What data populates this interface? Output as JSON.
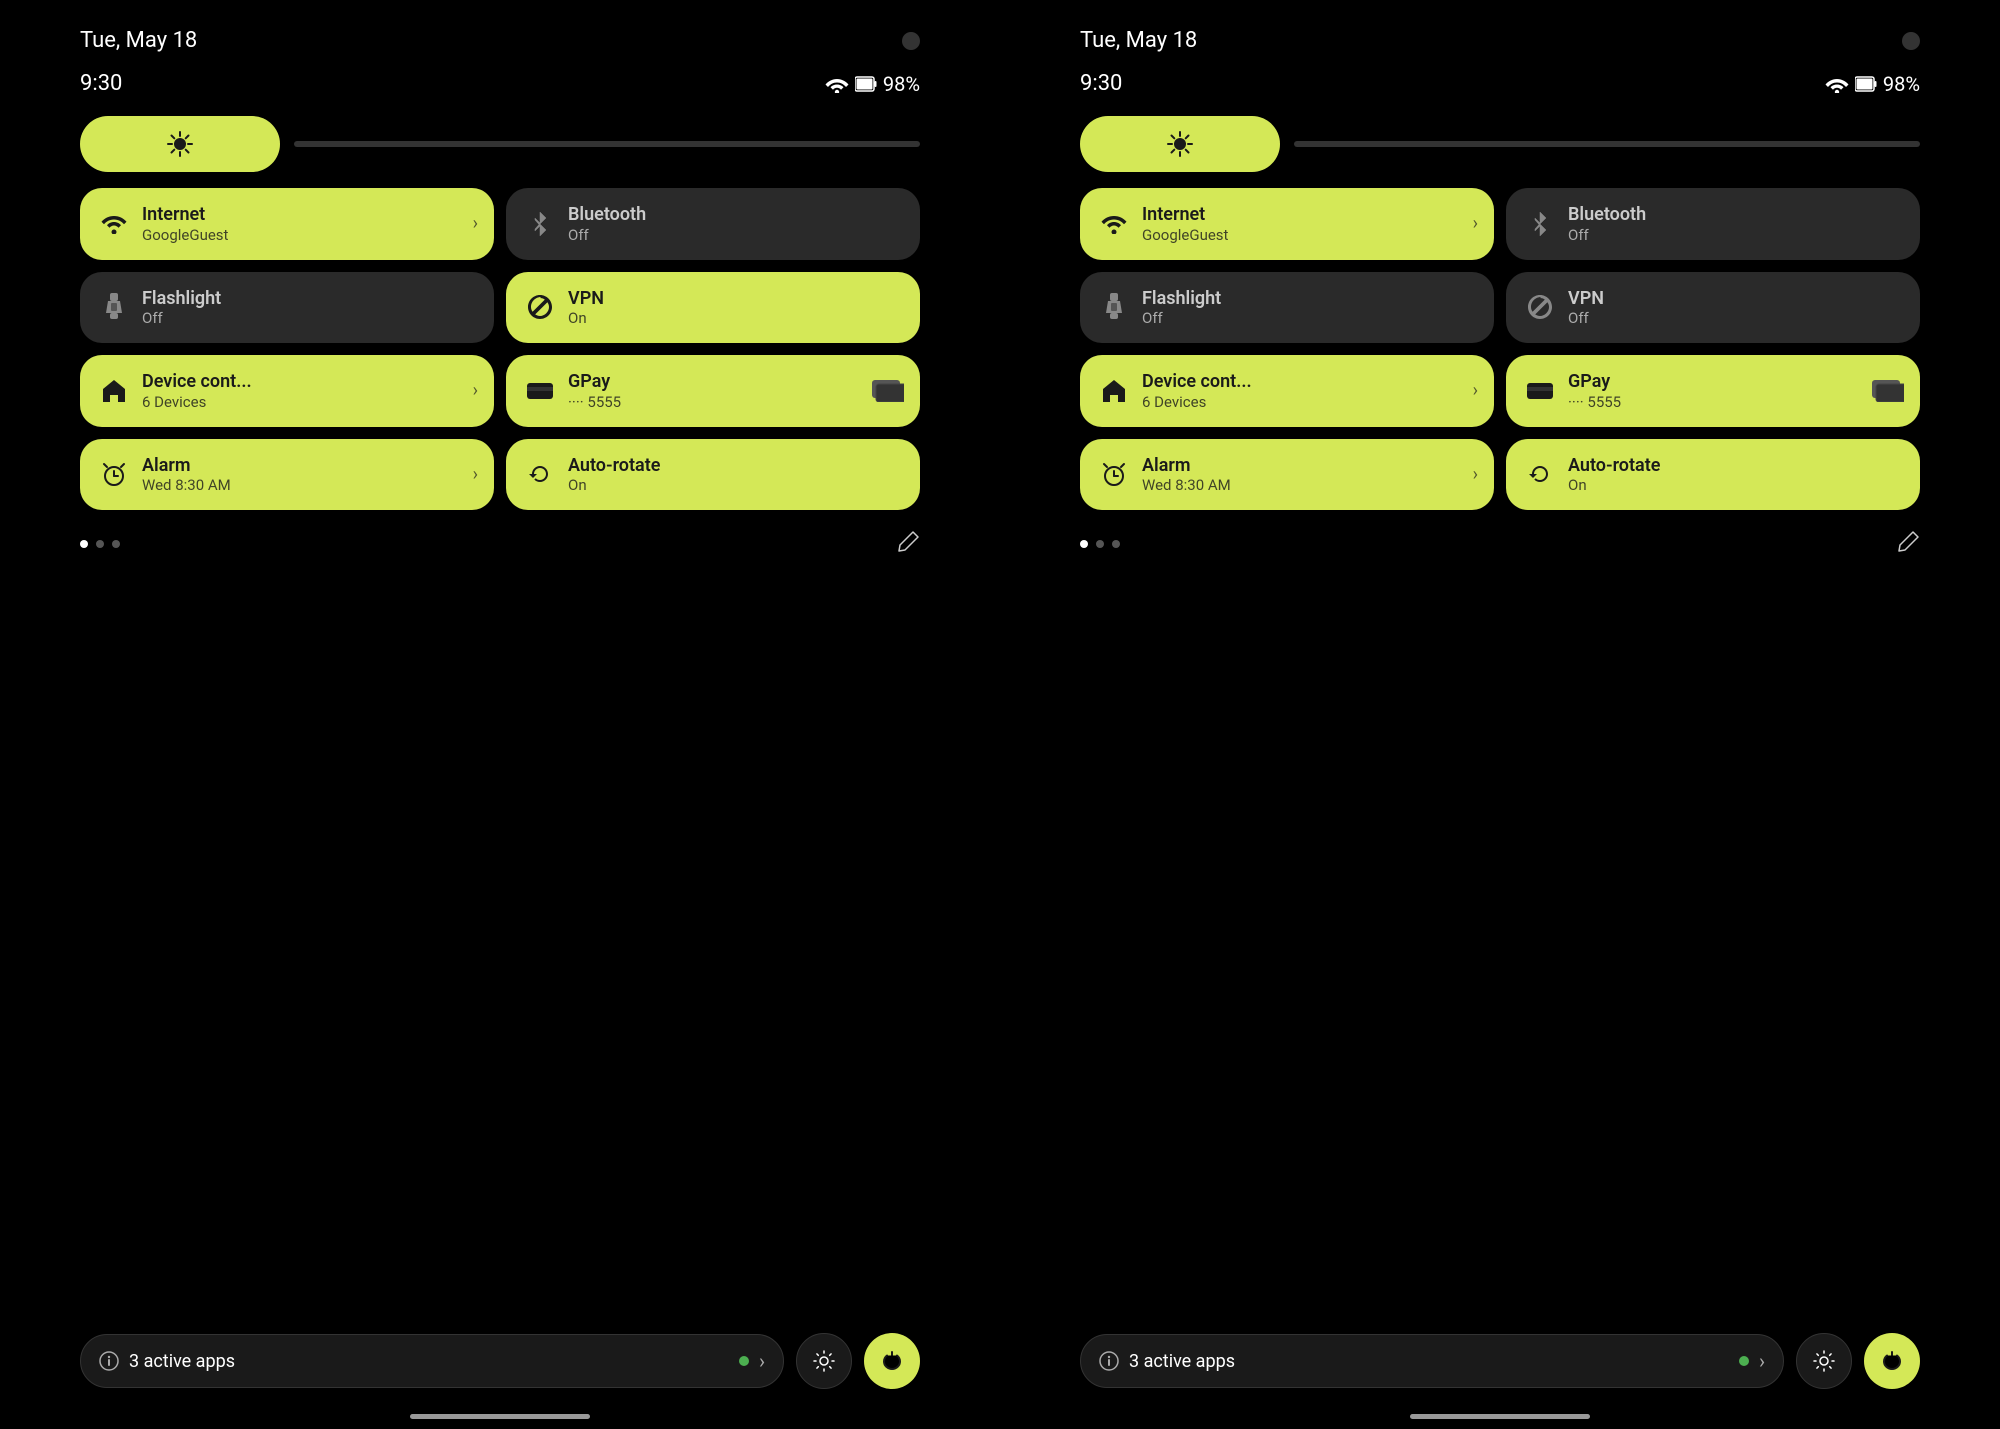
{
  "panels": [
    {
      "id": "panel-left",
      "status": {
        "date": "Tue, May 18",
        "time": "9:30",
        "battery": "98%",
        "wifi": true,
        "battery_icon": "🔋"
      },
      "brightness": {
        "icon": "⚙"
      },
      "tiles": [
        {
          "id": "internet",
          "icon": "wifi",
          "title": "Internet",
          "subtitle": "GoogleGuest",
          "active": true,
          "has_arrow": true
        },
        {
          "id": "bluetooth",
          "icon": "bluetooth",
          "title": "Bluetooth",
          "subtitle": "Off",
          "active": false,
          "has_arrow": false
        },
        {
          "id": "flashlight",
          "icon": "flashlight",
          "title": "Flashlight",
          "subtitle": "Off",
          "active": false,
          "has_arrow": false
        },
        {
          "id": "vpn",
          "icon": "vpn",
          "title": "VPN",
          "subtitle": "On",
          "active": true,
          "has_arrow": false
        },
        {
          "id": "device-control",
          "icon": "home",
          "title": "Device cont...",
          "subtitle": "6 Devices",
          "active": true,
          "has_arrow": true
        },
        {
          "id": "gpay",
          "icon": "gpay",
          "title": "GPay",
          "subtitle": "···· 5555",
          "active": true,
          "has_arrow": false,
          "has_card": true
        },
        {
          "id": "alarm",
          "icon": "alarm",
          "title": "Alarm",
          "subtitle": "Wed 8:30 AM",
          "active": true,
          "has_arrow": true
        },
        {
          "id": "autorotate",
          "icon": "rotate",
          "title": "Auto-rotate",
          "subtitle": "On",
          "active": true,
          "has_arrow": false
        }
      ],
      "pagination": {
        "active_dot": 0,
        "total_dots": 3
      },
      "bottom": {
        "active_apps_count": "3",
        "active_apps_label": "active apps"
      }
    },
    {
      "id": "panel-right",
      "status": {
        "date": "Tue, May 18",
        "time": "9:30",
        "battery": "98%",
        "wifi": true,
        "battery_icon": "🔋"
      },
      "brightness": {
        "icon": "⚙"
      },
      "tiles": [
        {
          "id": "internet",
          "icon": "wifi",
          "title": "Internet",
          "subtitle": "GoogleGuest",
          "active": true,
          "has_arrow": true
        },
        {
          "id": "bluetooth",
          "icon": "bluetooth",
          "title": "Bluetooth",
          "subtitle": "Off",
          "active": false,
          "has_arrow": false
        },
        {
          "id": "flashlight",
          "icon": "flashlight",
          "title": "Flashlight",
          "subtitle": "Off",
          "active": false,
          "has_arrow": false
        },
        {
          "id": "vpn",
          "icon": "vpn",
          "title": "VPN",
          "subtitle": "Off",
          "active": false,
          "has_arrow": false
        },
        {
          "id": "device-control",
          "icon": "home",
          "title": "Device cont...",
          "subtitle": "6 Devices",
          "active": true,
          "has_arrow": true
        },
        {
          "id": "gpay",
          "icon": "gpay",
          "title": "GPay",
          "subtitle": "···· 5555",
          "active": true,
          "has_arrow": false,
          "has_card": true
        },
        {
          "id": "alarm",
          "icon": "alarm",
          "title": "Alarm",
          "subtitle": "Wed 8:30 AM",
          "active": true,
          "has_arrow": true
        },
        {
          "id": "autorotate",
          "icon": "rotate",
          "title": "Auto-rotate",
          "subtitle": "On",
          "active": true,
          "has_arrow": false
        }
      ],
      "pagination": {
        "active_dot": 0,
        "total_dots": 3
      },
      "bottom": {
        "active_apps_count": "3",
        "active_apps_label": "active apps"
      }
    }
  ],
  "icons": {
    "wifi": "▾",
    "bluetooth": "✱",
    "flashlight": "◎",
    "vpn": "⬡",
    "home": "⌂",
    "gpay": "▬",
    "alarm": "◷",
    "rotate": "↻",
    "edit": "✎",
    "info": "ⓘ",
    "settings": "⚙",
    "power": "⏻",
    "chevron_right": "›",
    "card": "▬"
  },
  "colors": {
    "accent": "#d4e857",
    "tile_inactive_bg": "#2a2a2a",
    "tile_active_bg": "#d4e857",
    "bg": "#000000",
    "text_on_accent": "#1a1a1a",
    "text_on_dark": "#cccccc"
  }
}
